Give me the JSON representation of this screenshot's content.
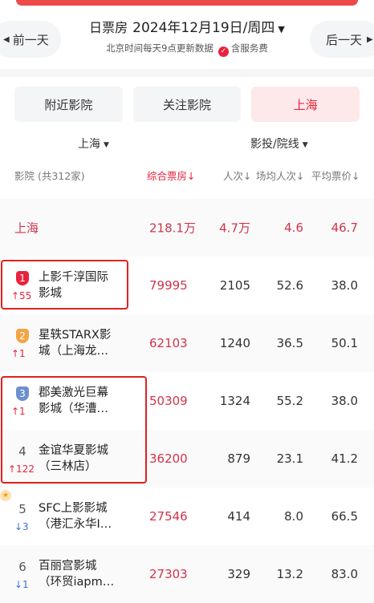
{
  "header": {
    "prev_label": "前一天",
    "next_label": "后一天",
    "title_label": "日票房",
    "date": "2024年12月19日/周四",
    "update_note": "北京时间每天9点更新数据",
    "fee_note": "含服务费"
  },
  "tabs": [
    {
      "label": "附近影院",
      "active": false
    },
    {
      "label": "关注影院",
      "active": false
    },
    {
      "label": "上海",
      "active": true
    }
  ],
  "filters": {
    "city": "上海",
    "type": "影投/院线"
  },
  "columns": {
    "name": "影院 (共312家)",
    "box": "综合票房↓",
    "people": "人次↓",
    "avg": "场均人次↓",
    "price": "平均票价↓"
  },
  "total": {
    "name": "上海",
    "box": "218.1万",
    "people": "4.7万",
    "avg": "4.6",
    "price": "46.7"
  },
  "rows": [
    {
      "rank": "1",
      "trend": "↑55",
      "dir": "up",
      "name1": "上影千淳国际",
      "name2": "影城",
      "box": "79995",
      "people": "2105",
      "avg": "52.6",
      "price": "38.0"
    },
    {
      "rank": "2",
      "trend": "↑1",
      "dir": "up",
      "name1": "星轶STARX影",
      "name2": "城（上海龙…",
      "box": "62103",
      "people": "1240",
      "avg": "36.5",
      "price": "50.1"
    },
    {
      "rank": "3",
      "trend": "↑1",
      "dir": "up",
      "name1": "郡美激光巨幕",
      "name2": "影城（华漕…",
      "box": "50309",
      "people": "1324",
      "avg": "55.2",
      "price": "38.0"
    },
    {
      "rank": "4",
      "trend": "↑122",
      "dir": "up",
      "name1": "金谊华夏影城",
      "name2": "（三林店）",
      "box": "36200",
      "people": "879",
      "avg": "23.1",
      "price": "41.2"
    },
    {
      "rank": "5",
      "trend": "↓3",
      "dir": "down",
      "name1": "SFC上影影城",
      "name2": "（港汇永华I…",
      "box": "27546",
      "people": "414",
      "avg": "8.0",
      "price": "66.5"
    },
    {
      "rank": "6",
      "trend": "↓1",
      "dir": "down",
      "name1": "百丽宫影城",
      "name2": "（环贸iapm…",
      "box": "27303",
      "people": "329",
      "avg": "13.2",
      "price": "83.0"
    }
  ]
}
